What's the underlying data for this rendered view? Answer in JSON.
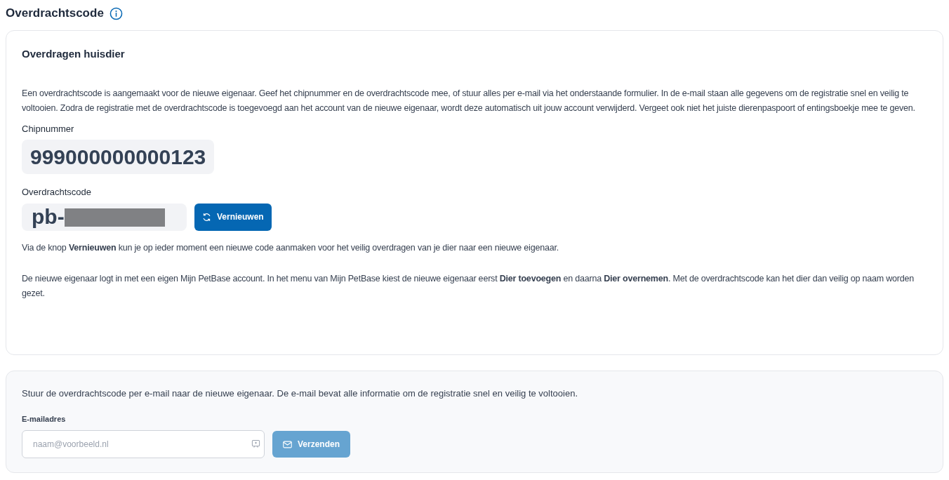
{
  "page_title": "Overdrachtscode",
  "transfer_card": {
    "title": "Overdragen huisdier",
    "intro": "Een overdrachtscode is aangemaakt voor de nieuwe eigenaar. Geef het chipnummer en de overdrachtscode mee, of stuur alles per e-mail via het onderstaande formulier. In de e-mail staan alle gegevens om de registratie snel en veilig te voltooien. Zodra de registratie met de overdrachtscode is toegevoegd aan het account van de nieuwe eigenaar, wordt deze automatisch uit jouw account verwijderd. Vergeet ook niet het juiste dierenpaspoort of entingsboekje mee te geven.",
    "chip_label": "Chipnummer",
    "chip_value": "999000000000123",
    "code_label": "Overdrachtscode",
    "code_value": "pb-",
    "code_redacted": true,
    "renew_button": "Vernieuwen",
    "notes": [
      "Via de knop **Vernieuwen** kun je op ieder moment een nieuwe code aanmaken voor het veilig overdragen van je dier naar een nieuwe eigenaar.",
      "De nieuwe eigenaar logt in met een eigen Mijn PetBase account. In het menu van Mijn PetBase kiest de nieuwe eigenaar eerst **Dier toevoegen** en daarna **Dier overnemen**. Met de overdrachtscode kan het dier dan veilig op naam worden gezet."
    ]
  },
  "email_card": {
    "text": "Stuur de overdrachtscode per e-mail naar de nieuwe eigenaar. De e-mail bevat alle informatie om de registratie snel en veilig te voltooien.",
    "field_label": "E-mailadres",
    "placeholder": "naam@voorbeeld.nl",
    "send_button": {
      "label": "Verzenden",
      "disabled": true
    }
  }
}
